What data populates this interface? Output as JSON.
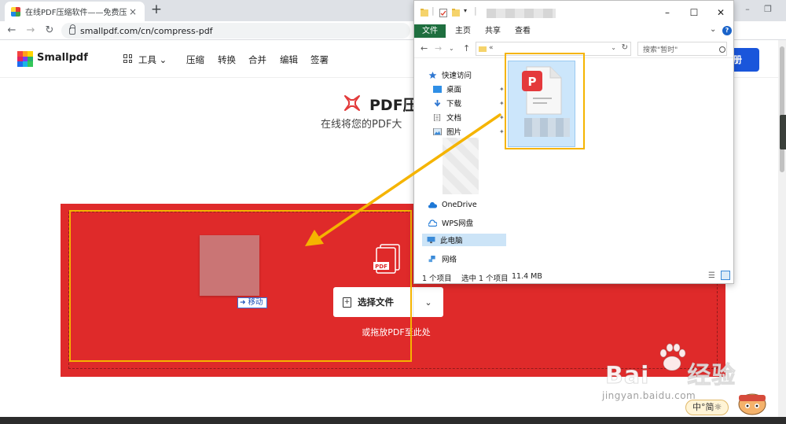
{
  "browser": {
    "tab_title": "在线PDF压缩软件——免费压缩",
    "tab_close": "×",
    "new_tab": "+",
    "url": "smallpdf.com/cn/compress-pdf"
  },
  "site": {
    "logo_text": "Smallpdf",
    "nav": {
      "tools": "工具",
      "compress": "压缩",
      "convert": "转换",
      "merge": "合并",
      "edit": "编辑",
      "sign": "签署"
    },
    "signup_partial": "册",
    "hero_title": "PDF压",
    "hero_sub": "在线将您的PDF大",
    "select_file": "选择文件",
    "drop_hint": "或拖放PDF至此处",
    "move_tip": "移动",
    "brand_colors": {
      "red": "#df2a2a",
      "highlight": "#f5b400",
      "primary_blue": "#1a56db"
    }
  },
  "explorer": {
    "ribbon_tabs": [
      "文件",
      "主页",
      "共享",
      "查看"
    ],
    "path_prefix": "«",
    "search_placeholder": "搜索\"暂时\"",
    "quick_access": "快速访问",
    "desktop": "桌面",
    "downloads": "下载",
    "documents": "文档",
    "pictures": "图片",
    "onedrive": "OneDrive",
    "wps": "WPS网盘",
    "this_pc": "此电脑",
    "network": "网络",
    "status_items": "1 个项目",
    "status_selected": "选中 1 个项目",
    "status_size": "11.4 MB"
  },
  "watermark": {
    "brand": "Bai",
    "brand_cn": "经验",
    "url": "jingyan.baidu.com",
    "ime": "中°简☼"
  }
}
